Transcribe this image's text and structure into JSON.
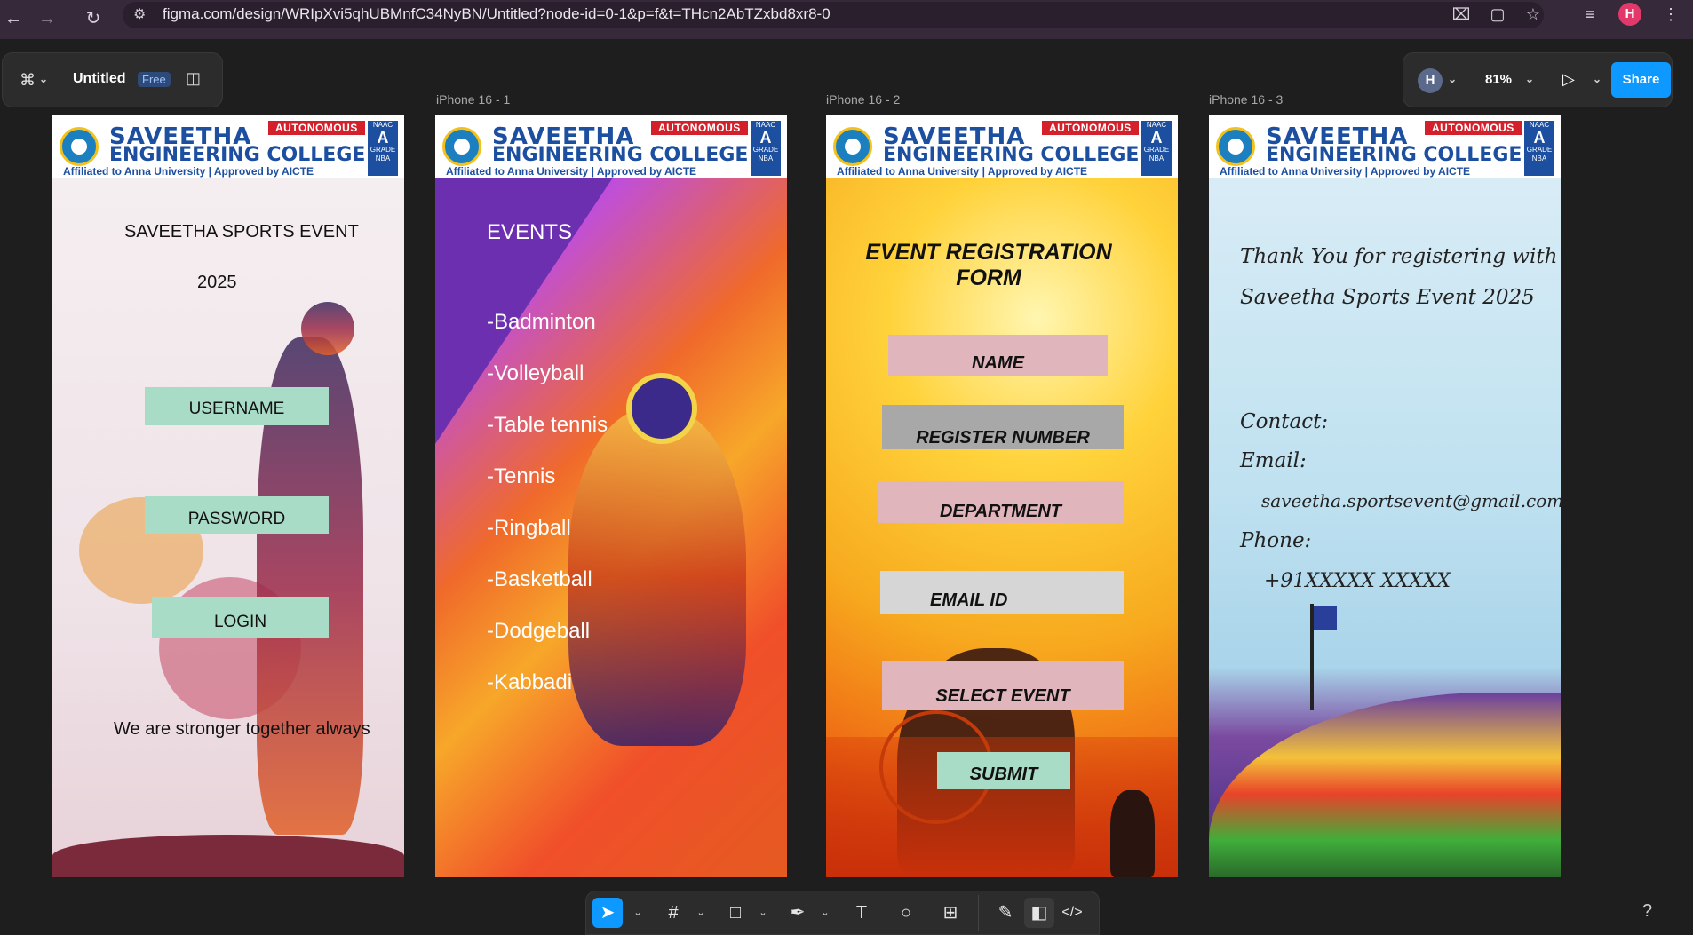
{
  "browser": {
    "url": "figma.com/design/WRIpXvi5qhUBMnfC34NyBN/Untitled?node-id=0-1&p=f&t=THcn2AbTZxbd8xr8-0",
    "avatar_initial": "H"
  },
  "figma": {
    "file_name": "Untitled",
    "plan_badge": "Free",
    "user_initial": "H",
    "zoom": "81%",
    "share_label": "Share",
    "help_label": "?"
  },
  "frames": {
    "labels": [
      "iPhone 16 - 1",
      "iPhone 16 - 2",
      "iPhone 16 - 3"
    ],
    "header": {
      "line1": "SAVEETHA",
      "line2": "ENGINEERING COLLEGE",
      "affiliation": "Affiliated to Anna University | Approved by AICTE",
      "autonomous": "AUTONOMOUS",
      "naac_top": "NAAC",
      "naac_grade": "A",
      "naac_sub": "GRADE",
      "nba": "NBA"
    },
    "login": {
      "title": "SAVEETHA SPORTS EVENT",
      "year": "2025",
      "username": "USERNAME",
      "password": "PASSWORD",
      "login": "LOGIN",
      "tagline": "We are stronger together always"
    },
    "events": {
      "title": "EVENTS",
      "items": [
        "-Badminton",
        "-Volleyball",
        "-Table tennis",
        "-Tennis",
        "-Ringball",
        "-Basketball",
        "-Dodgeball",
        "-Kabbadi"
      ]
    },
    "registration": {
      "title_line1": "EVENT REGISTRATION",
      "title_line2": "FORM",
      "name": "NAME",
      "register_number": "REGISTER NUMBER",
      "department": "DEPARTMENT",
      "email": "EMAIL ID",
      "select_event": "SELECT EVENT",
      "submit": "SUBMIT"
    },
    "thanks": {
      "line1": "Thank You for registering  with",
      "line2": "Saveetha Sports Event 2025",
      "contact": "Contact:",
      "email_label": "Email:",
      "email": "saveetha.sportsevent@gmail.com",
      "phone_label": "Phone:",
      "phone": "+91XXXXX XXXXX"
    }
  },
  "colors": {
    "share": "#0d99ff",
    "canvas": "#1e1e1e",
    "field_green": "#a9dcc6",
    "field_pink": "#e0b5bb",
    "field_gray": "#c9c9c9"
  }
}
